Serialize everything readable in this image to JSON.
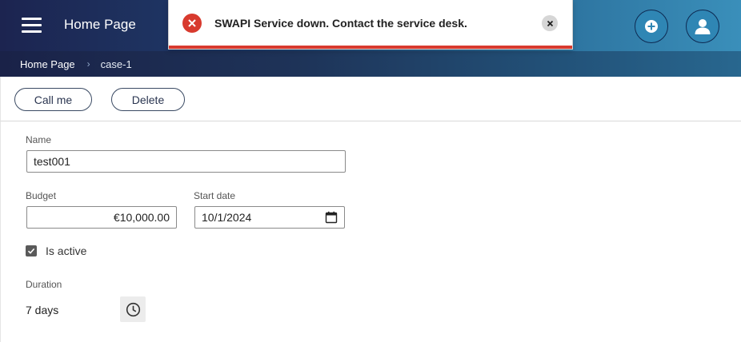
{
  "header": {
    "title": "Home Page",
    "menu_icon": "hamburger-icon",
    "add_icon": "add-circle-icon",
    "user_icon": "user-icon"
  },
  "breadcrumb": {
    "items": [
      {
        "label": "Home Page"
      },
      {
        "label": "case-1"
      }
    ]
  },
  "toolbar": {
    "call_label": "Call me",
    "delete_label": "Delete"
  },
  "form": {
    "name": {
      "label": "Name",
      "value": "test001"
    },
    "budget": {
      "label": "Budget",
      "value": "€10,000.00"
    },
    "start_date": {
      "label": "Start date",
      "value": "10/1/2024"
    },
    "is_active": {
      "label": "Is active",
      "checked": true
    },
    "duration": {
      "label": "Duration",
      "value": "7 days"
    }
  },
  "toast": {
    "message": "SWAPI Service down. Contact the service desk.",
    "type": "error",
    "close_icon": "close-icon"
  },
  "colors": {
    "error": "#d83a2e",
    "header_start": "#1c2450",
    "header_end": "#3a8fba"
  }
}
